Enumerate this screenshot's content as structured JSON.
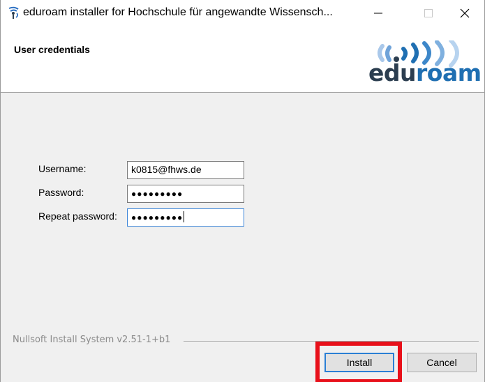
{
  "window": {
    "title": "eduroam installer for Hochschule für angewandte Wissensch..."
  },
  "header": {
    "title": "User credentials",
    "logo_edu": "edu",
    "logo_roam": "roam"
  },
  "form": {
    "username_label": "Username:",
    "username_value": "k0815@fhws.de",
    "password_label": "Password:",
    "password_mask": "●●●●●●●●●",
    "repeat_label": "Repeat password:",
    "repeat_mask": "●●●●●●●●●"
  },
  "footer": {
    "branding": "Nullsoft Install System v2.51-1+b1",
    "install_label": "Install",
    "cancel_label": "Cancel"
  },
  "colors": {
    "highlight": "#e8101a",
    "focus": "#2a7fd4",
    "logo_blue": "#1f6fb2"
  },
  "icons": [
    "app-icon",
    "minimize-icon",
    "maximize-icon",
    "close-icon",
    "eduroam-logo"
  ]
}
